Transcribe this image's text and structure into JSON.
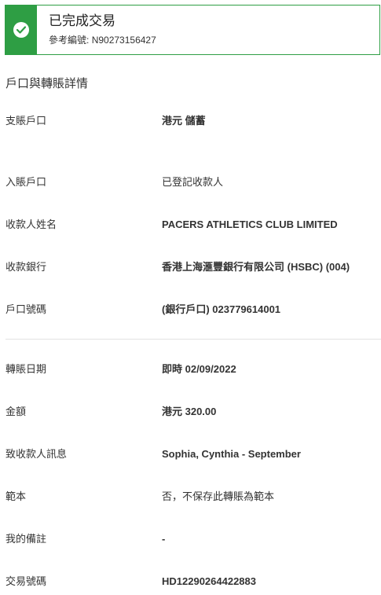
{
  "banner": {
    "title": "已完成交易",
    "reference_label": "參考編號:",
    "reference_number": "N90273156427",
    "icon": "checkmark-icon",
    "accent_color": "#2e9e44"
  },
  "section_title": "戶口與轉賬詳情",
  "details": {
    "from_account": {
      "label": "支賬戶口",
      "value": "港元 儲蓄"
    },
    "to_account": {
      "label": "入賬戶口",
      "value": "已登記收款人"
    },
    "payee_name": {
      "label": "收款人姓名",
      "value": "PACERS ATHLETICS CLUB LIMITED"
    },
    "payee_bank": {
      "label": "收款銀行",
      "value": "香港上海滙豐銀行有限公司 (HSBC) (004)"
    },
    "account_number": {
      "label": "戶口號碼",
      "value": "(銀行戶口) 023779614001"
    },
    "transfer_date": {
      "label": "轉賬日期",
      "value": "即時 02/09/2022"
    },
    "amount": {
      "label": "金額",
      "value": "港元 320.00"
    },
    "message": {
      "label": "致收款人訊息",
      "value": "Sophia, Cynthia - September"
    },
    "template": {
      "label": "範本",
      "value": "否，不保存此轉賬為範本"
    },
    "my_note": {
      "label": "我的備註",
      "value": "-"
    },
    "transaction_number": {
      "label": "交易號碼",
      "value": "HD12290264422883"
    }
  }
}
